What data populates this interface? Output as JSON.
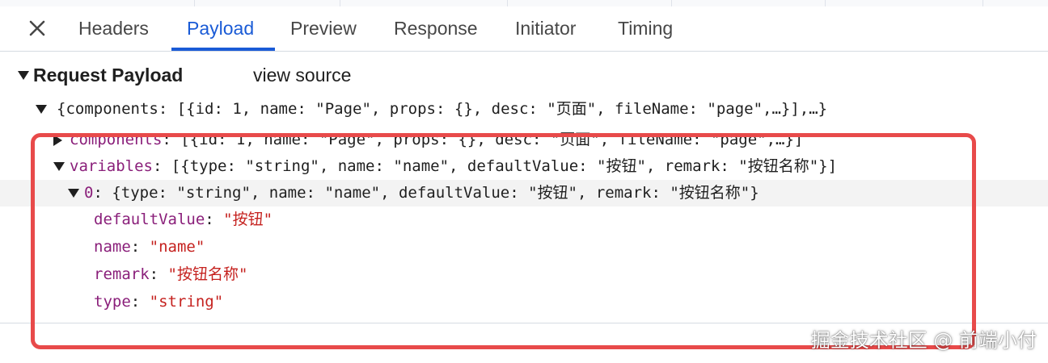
{
  "tabs": [
    {
      "label": "Headers"
    },
    {
      "label": "Payload"
    },
    {
      "label": "Preview"
    },
    {
      "label": "Response"
    },
    {
      "label": "Initiator"
    },
    {
      "label": "Timing"
    }
  ],
  "active_tab": "Payload",
  "section": {
    "title": "Request Payload",
    "view_source": "view source"
  },
  "tree": {
    "root_summary": "{components: [{id: 1, name: \"Page\", props: {}, desc: \"页面\", fileName: \"page\",…}],…}",
    "components": {
      "key": "components",
      "summary": "[{id: 1, name: \"Page\", props: {}, desc: \"页面\", fileName: \"page\",…}]"
    },
    "variables": {
      "key": "variables",
      "summary": "[{type: \"string\", name: \"name\", defaultValue: \"按钮\", remark: \"按钮名称\"}]"
    },
    "item0": {
      "key": "0",
      "summary": "{type: \"string\", name: \"name\", defaultValue: \"按钮\", remark: \"按钮名称\"}"
    },
    "props": [
      {
        "key": "defaultValue",
        "value": "\"按钮\""
      },
      {
        "key": "name",
        "value": "\"name\""
      },
      {
        "key": "remark",
        "value": "\"按钮名称\""
      },
      {
        "key": "type",
        "value": "\"string\""
      }
    ]
  },
  "watermark": "掘金技术社区 @ 前端小付",
  "colors": {
    "accent": "#1a5bd6",
    "key": "#8a1f7a",
    "string": "#c5221f",
    "highlight_border": "#e84a4a",
    "selected_row": "#f3f3f3"
  }
}
